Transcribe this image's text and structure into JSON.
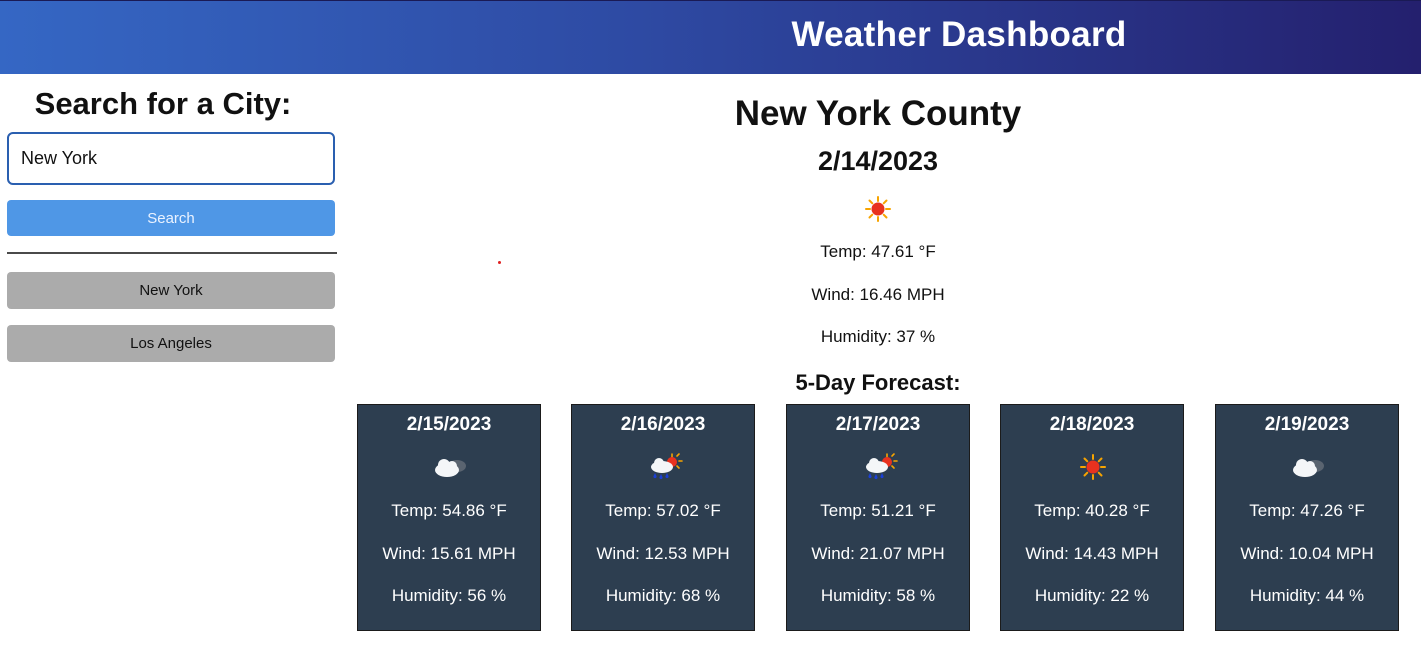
{
  "header": {
    "title": "Weather Dashboard"
  },
  "sidebar": {
    "search_title": "Search for a City:",
    "search_value": "New York",
    "search_button": "Search",
    "history": [
      "New York",
      "Los Angeles"
    ]
  },
  "current": {
    "city": "New York County",
    "date": "2/14/2023",
    "icon": "sun-icon",
    "temp": "Temp: 47.61 °F",
    "wind": "Wind: 16.46 MPH",
    "humidity": "Humidity: 37 %"
  },
  "forecast": {
    "title": "5-Day Forecast:",
    "days": [
      {
        "date": "2/15/2023",
        "icon": "cloudy-icon",
        "temp": "Temp: 54.86 °F",
        "wind": "Wind: 15.61 MPH",
        "humidity": "Humidity: 56 %"
      },
      {
        "date": "2/16/2023",
        "icon": "sun-rain-cloud-icon",
        "temp": "Temp: 57.02 °F",
        "wind": "Wind: 12.53 MPH",
        "humidity": "Humidity: 68 %"
      },
      {
        "date": "2/17/2023",
        "icon": "sun-rain-cloud-icon",
        "temp": "Temp: 51.21 °F",
        "wind": "Wind: 21.07 MPH",
        "humidity": "Humidity: 58 %"
      },
      {
        "date": "2/18/2023",
        "icon": "sun-icon",
        "temp": "Temp: 40.28 °F",
        "wind": "Wind: 14.43 MPH",
        "humidity": "Humidity: 22 %"
      },
      {
        "date": "2/19/2023",
        "icon": "cloudy-icon",
        "temp": "Temp: 47.26 °F",
        "wind": "Wind: 10.04 MPH",
        "humidity": "Humidity: 44 %"
      }
    ]
  },
  "colors": {
    "header_start": "#3567c4",
    "header_end": "#24206e",
    "search_button": "#4f97e6",
    "history_button": "#ababab",
    "card_background": "#2d3e50"
  }
}
